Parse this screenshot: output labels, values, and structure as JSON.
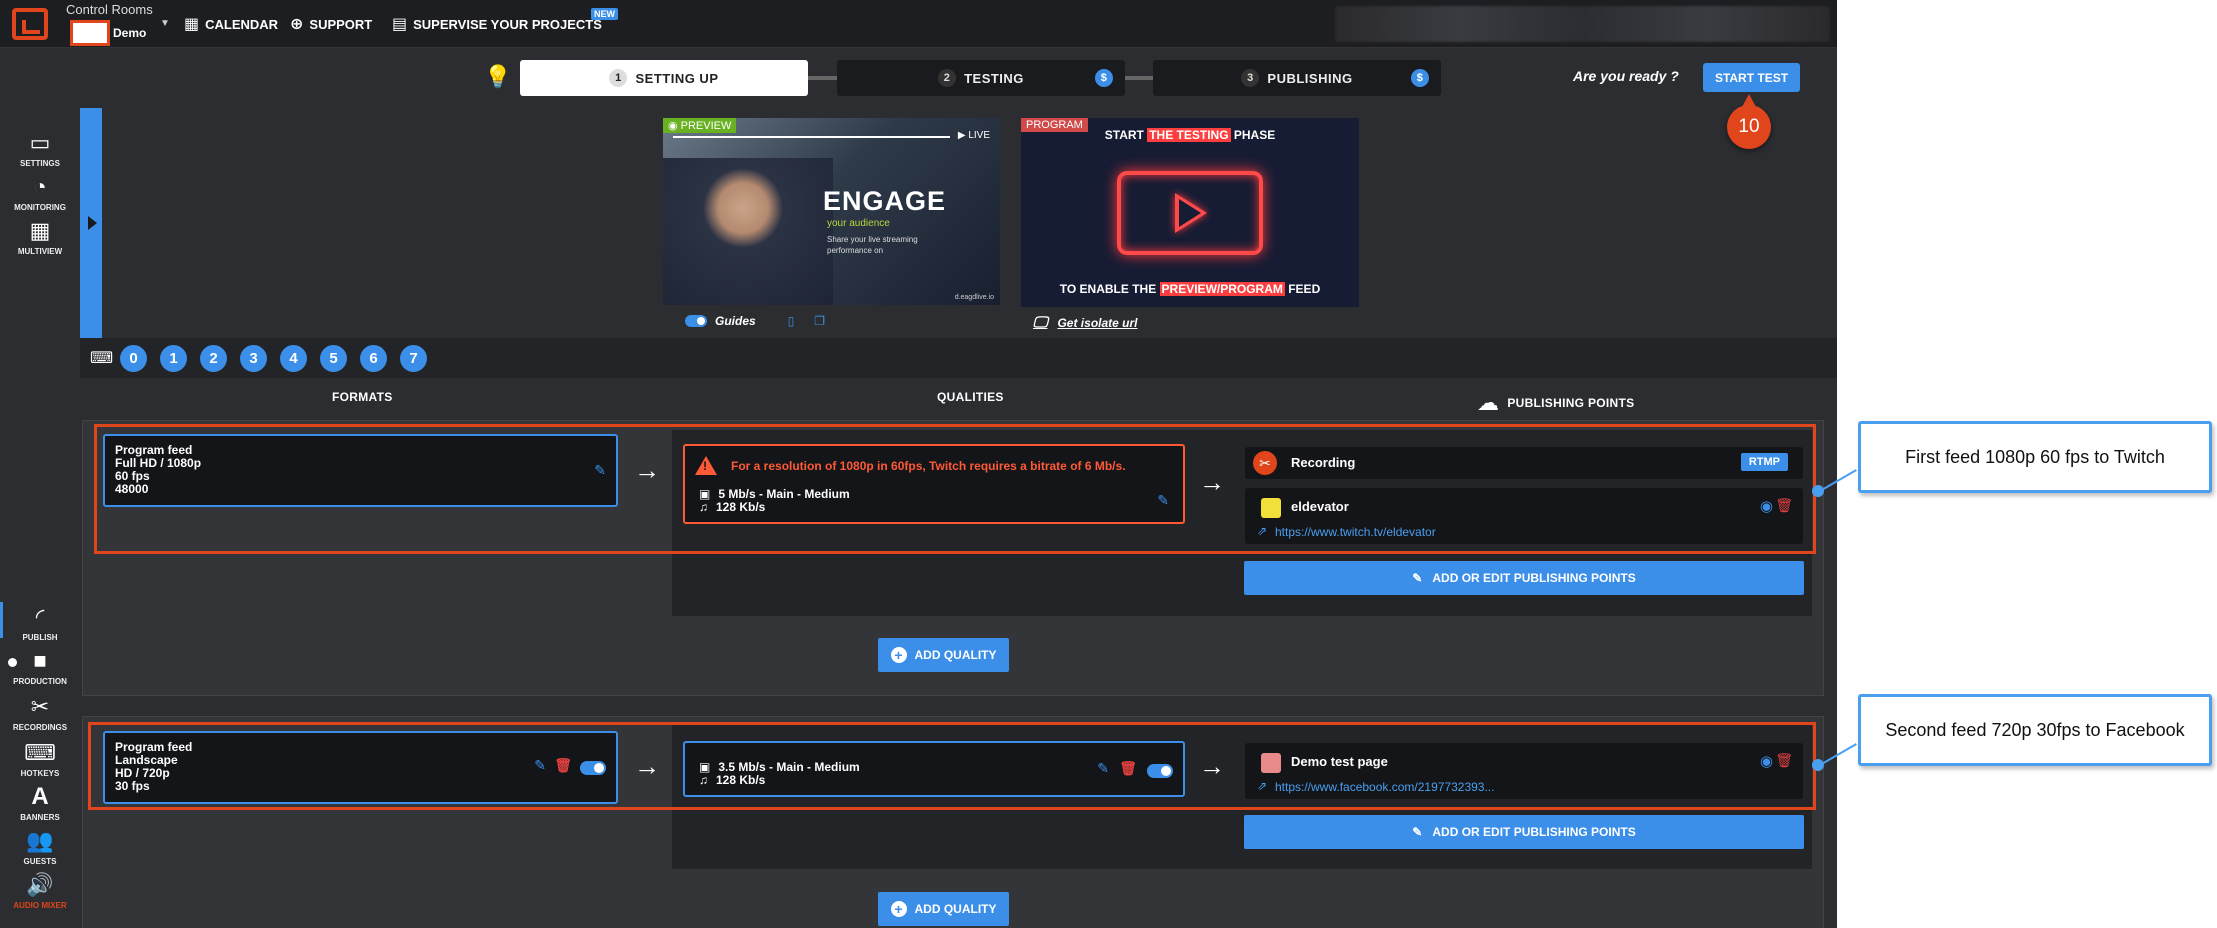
{
  "topbar": {
    "app_title": "Control Rooms",
    "org_name": "Demo",
    "nav": [
      {
        "label": "CALENDAR",
        "icon": "calendar-icon"
      },
      {
        "label": "SUPPORT",
        "icon": "lifebuoy-icon"
      },
      {
        "label": "SUPERVISE YOUR PROJECTS",
        "icon": "grid-icon"
      }
    ],
    "new_badge": "NEW"
  },
  "steps": [
    {
      "num": "1",
      "label": "SETTING UP",
      "active": true
    },
    {
      "num": "2",
      "label": "TESTING",
      "dollar": "$"
    },
    {
      "num": "3",
      "label": "PUBLISHING",
      "dollar": "$"
    }
  ],
  "ready_text": "Are you ready ?",
  "start_test_label": "START TEST",
  "annotation_number": "10",
  "sidebar": {
    "top": [
      {
        "label": "SETTINGS",
        "icon": "settings-icon"
      },
      {
        "label": "MONITORING",
        "icon": "gauge-icon"
      },
      {
        "label": "MULTIVIEW",
        "icon": "multiview-icon"
      }
    ],
    "bottom": [
      {
        "label": "PUBLISH",
        "icon": "publish-icon"
      },
      {
        "label": "PRODUCTION",
        "icon": "camera-icon"
      },
      {
        "label": "RECORDINGS",
        "icon": "scissors-icon"
      },
      {
        "label": "HOTKEYS",
        "icon": "keyboard-icon"
      },
      {
        "label": "BANNERS",
        "icon": "letter-a-icon"
      },
      {
        "label": "GUESTS",
        "icon": "users-icon"
      },
      {
        "label": "AUDIO MIXER",
        "icon": "speaker-icon"
      }
    ]
  },
  "preview": {
    "label": "PREVIEW",
    "live": "LIVE",
    "engage": "ENGAGE",
    "engage_sub": "your audience",
    "engage_desc": "Share your live streaming performance on",
    "watermark": "d.eagdlive.io"
  },
  "program": {
    "label": "PROGRAM",
    "top_pre": "START ",
    "top_hl": "THE TESTING",
    "top_post": " PHASE",
    "bottom_pre": "TO ENABLE THE ",
    "bottom_hl": "PREVIEW/PROGRAM",
    "bottom_post": " FEED"
  },
  "guides_label": "Guides",
  "isolate_label": "Get isolate url",
  "feed_numbers": [
    "0",
    "1",
    "2",
    "3",
    "4",
    "5",
    "6",
    "7"
  ],
  "columns": {
    "formats": "FORMATS",
    "qualities": "QUALITIES",
    "publishing_points": "PUBLISHING POINTS"
  },
  "feeds": [
    {
      "format_lines": [
        "Program feed",
        "Full HD / 1080p",
        "60 fps",
        "48000"
      ],
      "warning": "For a resolution of 1080p in 60fps, Twitch requires a bitrate of 6 Mb/s.",
      "video_quality": "5 Mb/s  -  Main  -  Medium",
      "audio_quality": "128 Kb/s",
      "points": [
        {
          "name": "Recording",
          "badge": "RTMP"
        },
        {
          "name": "eldevator",
          "url": "https://www.twitch.tv/eldevator"
        }
      ],
      "pp_button": "ADD OR EDIT PUBLISHING POINTS",
      "add_quality": "ADD QUALITY"
    },
    {
      "format_lines": [
        "Program feed",
        "Landscape",
        "HD / 720p",
        "30 fps"
      ],
      "video_quality": "3.5 Mb/s  -  Main  -  Medium",
      "audio_quality": "128 Kb/s",
      "points": [
        {
          "name": "Demo test page",
          "url": "https://www.facebook.com/2197732393..."
        }
      ],
      "pp_button": "ADD OR EDIT PUBLISHING POINTS",
      "add_quality": "ADD QUALITY"
    }
  ],
  "callouts": [
    "First feed 1080p 60 fps to Twitch",
    "Second feed 720p 30fps to Facebook"
  ],
  "colors": {
    "accent": "#3b8fe8",
    "brand": "#e0451b",
    "warning": "#ff5a36",
    "danger": "#e04040"
  }
}
